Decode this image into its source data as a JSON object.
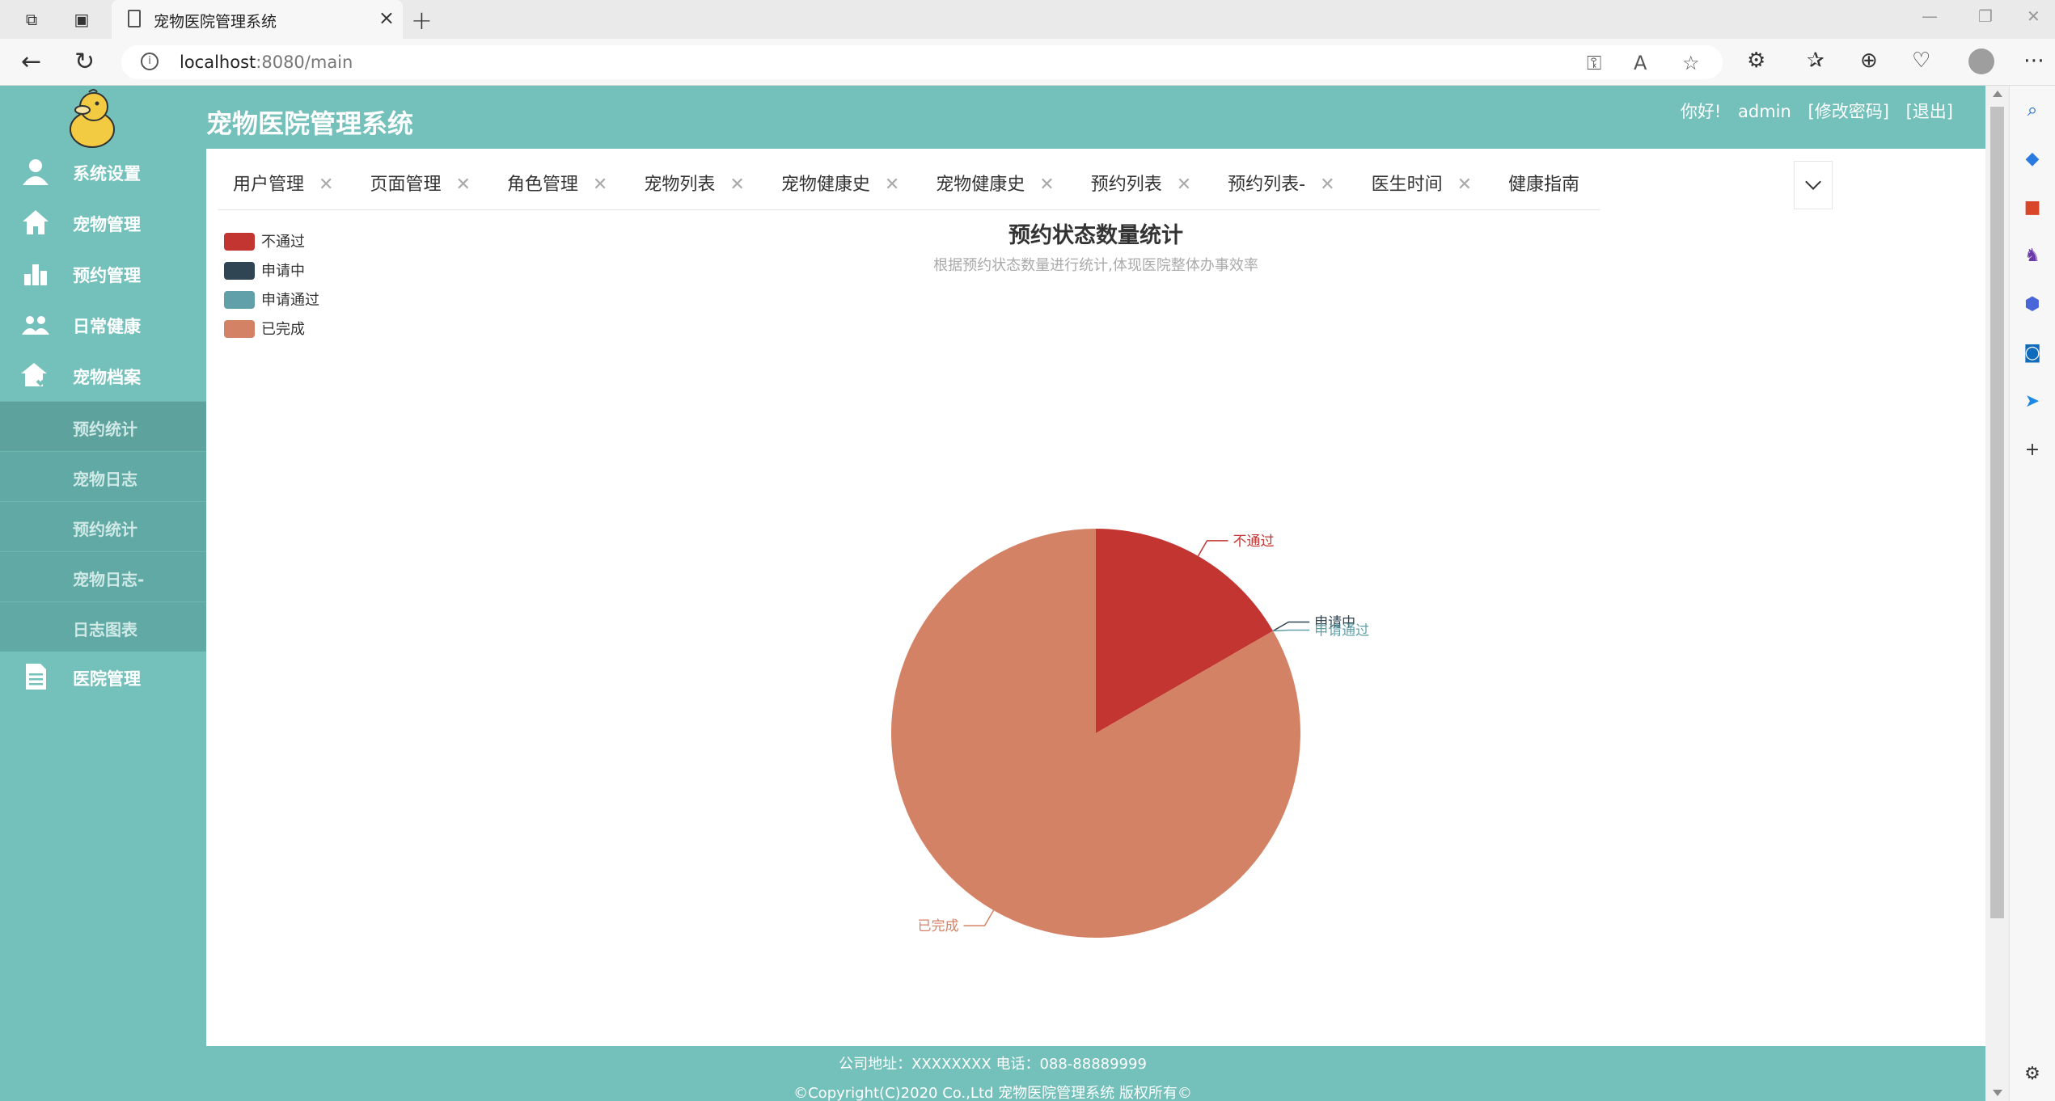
{
  "browser": {
    "tab_title": "宠物医院管理系统",
    "url_host": "localhost",
    "url_path": ":8080/main"
  },
  "app": {
    "title": "宠物医院管理系统",
    "greeting": "你好!",
    "username": "admin",
    "change_password": "[修改密码]",
    "logout": "[退出]"
  },
  "sidebar": {
    "menu": [
      {
        "label": "系统设置",
        "icon": "user-icon"
      },
      {
        "label": "宠物管理",
        "icon": "home-icon"
      },
      {
        "label": "预约管理",
        "icon": "bar-chart-icon"
      },
      {
        "label": "日常健康",
        "icon": "group-icon"
      },
      {
        "label": "宠物档案",
        "icon": "house-check-icon"
      }
    ],
    "submenu": [
      "预约统计",
      "宠物日志",
      "预约统计",
      "宠物日志-",
      "日志图表"
    ],
    "last_menu": {
      "label": "医院管理",
      "icon": "document-icon"
    }
  },
  "page_tabs": [
    "用户管理",
    "页面管理",
    "角色管理",
    "宠物列表",
    "宠物健康史",
    "宠物健康史",
    "预约列表",
    "预约列表-",
    "医生时间",
    "健康指南"
  ],
  "chart_data": {
    "type": "pie",
    "title": "预约状态数量统计",
    "subtitle": "根据预约状态数量进行统计,体现医院整体办事效率",
    "legend_position": "top-left",
    "categories": [
      "不通过",
      "申请中",
      "申请通过",
      "已完成"
    ],
    "values": [
      1,
      0,
      0,
      5
    ],
    "colors": [
      "#c23531",
      "#2f4554",
      "#61a0a8",
      "#d48265"
    ]
  },
  "footer": {
    "address_line": "公司地址：XXXXXXXX 电话：088-88889999",
    "copyright_line": "©Copyright(C)2020 Co.,Ltd 宠物医院管理系统 版权所有©"
  }
}
